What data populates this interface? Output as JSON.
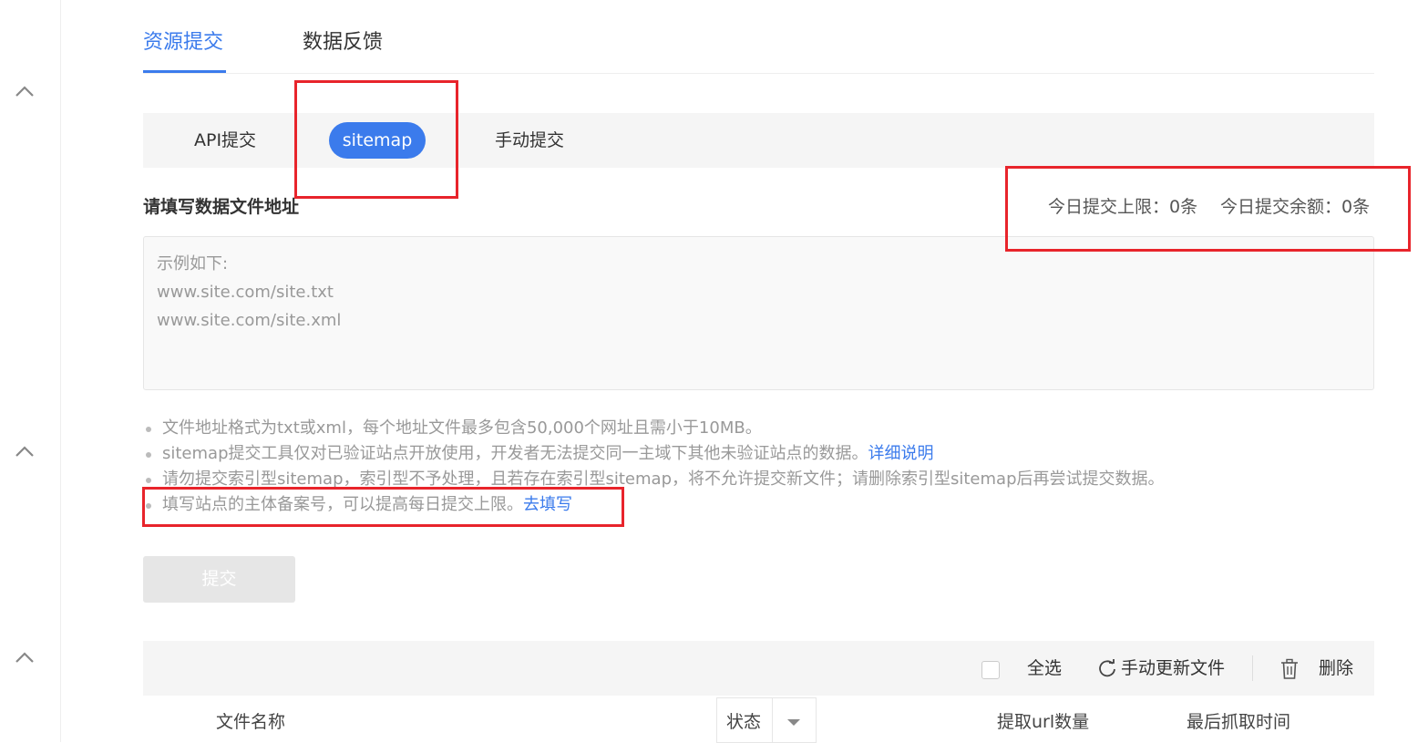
{
  "top_tabs": [
    {
      "label": "资源提交",
      "active": true
    },
    {
      "label": "数据反馈",
      "active": false
    }
  ],
  "sub_tabs": [
    {
      "label": "API提交",
      "active": false
    },
    {
      "label": "sitemap",
      "active": true
    },
    {
      "label": "手动提交",
      "active": false
    }
  ],
  "form": {
    "title": "请填写数据文件地址",
    "quota_limit": "今日提交上限：0条",
    "quota_remaining": "今日提交余额：0条",
    "placeholder": "示例如下:\nwww.site.com/site.txt\nwww.site.com/site.xml"
  },
  "notes": [
    {
      "text": "文件地址格式为txt或xml，每个地址文件最多包含50,000个网址且需小于10MB。"
    },
    {
      "text": "sitemap提交工具仅对已验证站点开放使用，开发者无法提交同一主域下其他未验证站点的数据。",
      "link": "详细说明"
    },
    {
      "text": "请勿提交索引型sitemap，索引型不予处理，且若存在索引型sitemap，将不允许提交新文件；请删除索引型sitemap后再尝试提交数据。"
    },
    {
      "text": "填写站点的主体备案号，可以提高每日提交上限。",
      "link": "去填写"
    }
  ],
  "submit_label": "提交",
  "toolbar": {
    "select_all": "全选",
    "refresh": "手动更新文件",
    "delete": "删除"
  },
  "table": {
    "headers": [
      "文件名称",
      "状态",
      "提取url数量",
      "最后抓取时间"
    ]
  },
  "colors": {
    "accent": "#3b7bec",
    "highlight": "#e8242b"
  }
}
